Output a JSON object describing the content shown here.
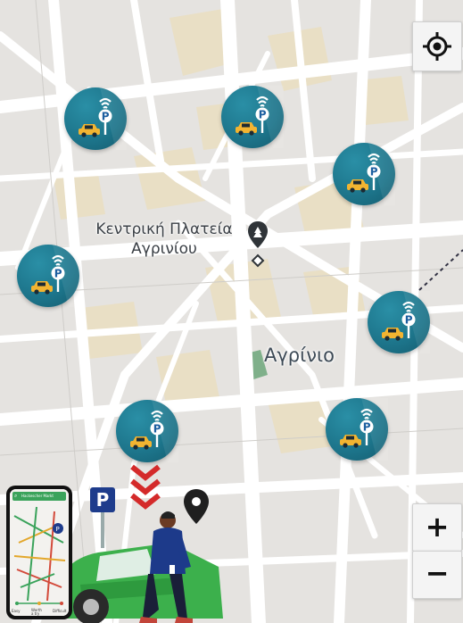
{
  "map": {
    "landmark_label_line1": "Κεντρική Πλατεία",
    "landmark_label_line2": "Αγρινίου",
    "city_label": "Αγρίνιο",
    "colors": {
      "background": "#e5e3e0",
      "road": "#ffffff",
      "block_tan": "#e9dfc5",
      "park_green": "#7fb08a",
      "marker_teal": "#1c7389"
    },
    "parking_markers": [
      {
        "name": "parking-marker-1",
        "icon": "parking-car-wifi-icon"
      },
      {
        "name": "parking-marker-2",
        "icon": "parking-car-wifi-icon"
      },
      {
        "name": "parking-marker-3",
        "icon": "parking-car-wifi-icon"
      },
      {
        "name": "parking-marker-4",
        "icon": "parking-car-wifi-icon"
      },
      {
        "name": "parking-marker-5",
        "icon": "parking-car-wifi-icon"
      },
      {
        "name": "parking-marker-6",
        "icon": "parking-car-wifi-icon"
      },
      {
        "name": "parking-marker-7",
        "icon": "parking-car-wifi-icon"
      }
    ]
  },
  "controls": {
    "locate_icon": "crosshair-icon",
    "zoom_in_label": "+",
    "zoom_out_label": "−"
  },
  "illustration": {
    "parking_sign": "P",
    "phone_search_text": "Hackescher Markt",
    "phone_legend": [
      "Easy",
      "Worth a try",
      "Difficult"
    ]
  }
}
